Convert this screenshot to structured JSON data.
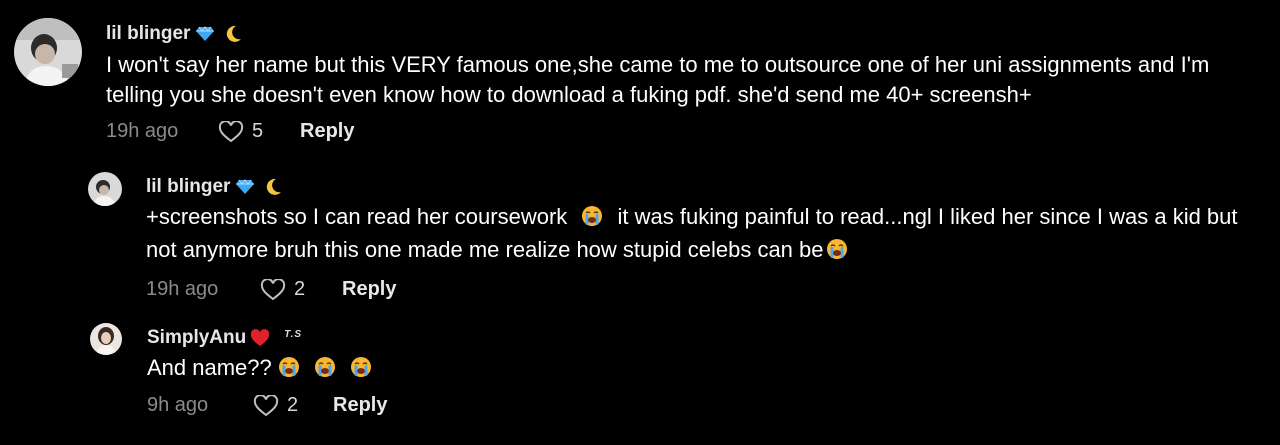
{
  "comments": [
    {
      "author": "lil blinger",
      "badges": [
        "diamond-icon",
        "crescent-moon-icon"
      ],
      "text": "I won't say her name but this VERY famous one,she came to me to outsource one of her uni assignments and I'm telling you she doesn't even know how to download a fuking pdf. she'd send me 40+ screensh+",
      "time": "19h ago",
      "likes": "5",
      "reply_label": "Reply"
    },
    {
      "author": "lil blinger",
      "badges": [
        "diamond-icon",
        "crescent-moon-icon"
      ],
      "text_part1": "+screenshots so I can read her coursework",
      "text_part2": "it was fuking painful to read...ngl I liked her since I was a kid but not anymore bruh this one made me realize how stupid celebs can be",
      "time": "19h ago",
      "likes": "2",
      "reply_label": "Reply"
    },
    {
      "author": "SimplyAnu",
      "badges": [
        "red-heart-icon"
      ],
      "ts_mark": "T.S",
      "text": "And name??",
      "time": "9h ago",
      "likes": "2",
      "reply_label": "Reply"
    }
  ],
  "colors": {
    "background": "#000000",
    "text": "#ffffff",
    "meta": "#8a8a8a",
    "heart_badge": "#e0202a",
    "diamond": "#3fa9f5",
    "moon": "#f5c542",
    "crying_face": "#f7b733"
  }
}
